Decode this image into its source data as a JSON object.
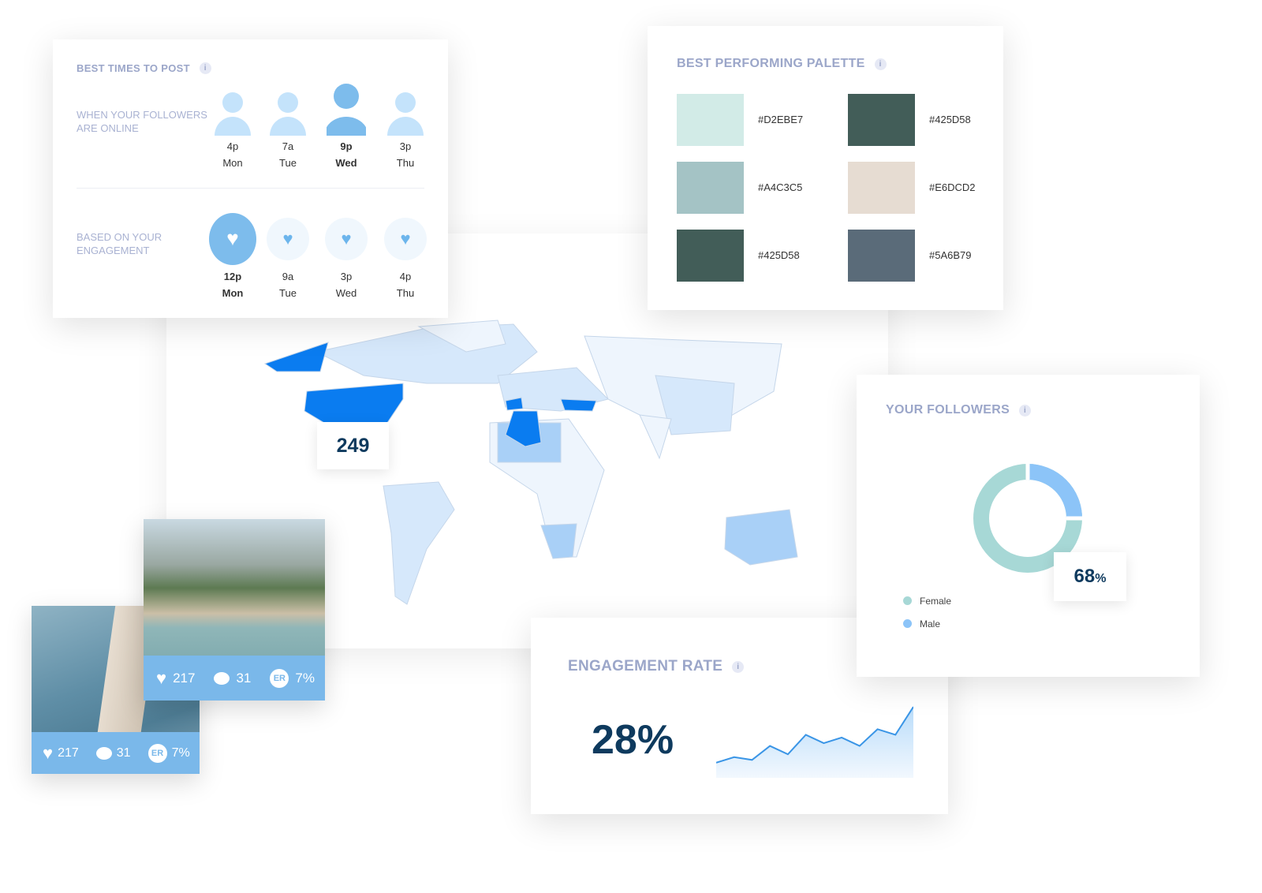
{
  "best_times": {
    "title": "BEST TIMES TO POST",
    "info_icon": "info-icon",
    "online_label": "WHEN YOUR FOLLOWERS ARE ONLINE",
    "online": [
      {
        "time": "4p",
        "day": "Mon",
        "highlight": false
      },
      {
        "time": "7a",
        "day": "Tue",
        "highlight": false
      },
      {
        "time": "9p",
        "day": "Wed",
        "highlight": true
      },
      {
        "time": "3p",
        "day": "Thu",
        "highlight": false
      }
    ],
    "engagement_label": "BASED ON YOUR ENGAGEMENT",
    "engagement": [
      {
        "time": "12p",
        "day": "Mon",
        "highlight": true
      },
      {
        "time": "9a",
        "day": "Tue",
        "highlight": false
      },
      {
        "time": "3p",
        "day": "Wed",
        "highlight": false
      },
      {
        "time": "4p",
        "day": "Thu",
        "highlight": false
      }
    ]
  },
  "palette": {
    "title": "BEST PERFORMING PALETTE",
    "swatches": [
      "#D2EBE7",
      "#425D58",
      "#A4C3C5",
      "#E6DCD2",
      "#425D58",
      "#5A6B79"
    ]
  },
  "map": {
    "count": "249",
    "highlight_color": "#0a7cf0",
    "light_color": "#cfe4fa"
  },
  "followers": {
    "title": "YOUR FOLLOWERS",
    "percent": "68",
    "percent_sign": "%",
    "legend": [
      {
        "label": "Female",
        "color": "#a7d8d6"
      },
      {
        "label": "Male",
        "color": "#8cc4f8"
      }
    ],
    "male_share": 0.25
  },
  "engagement_rate": {
    "title": "ENGAGEMENT RATE",
    "value": "28%",
    "chart_data": {
      "type": "area",
      "values": [
        2,
        3,
        2.5,
        5,
        3.5,
        7,
        5.5,
        6.5,
        5,
        8,
        7,
        12
      ]
    }
  },
  "posts": [
    {
      "likes": "217",
      "comments": "31",
      "er_badge": "ER",
      "er": "7%"
    },
    {
      "likes": "217",
      "comments": "31",
      "er_badge": "ER",
      "er": "7%"
    }
  ]
}
